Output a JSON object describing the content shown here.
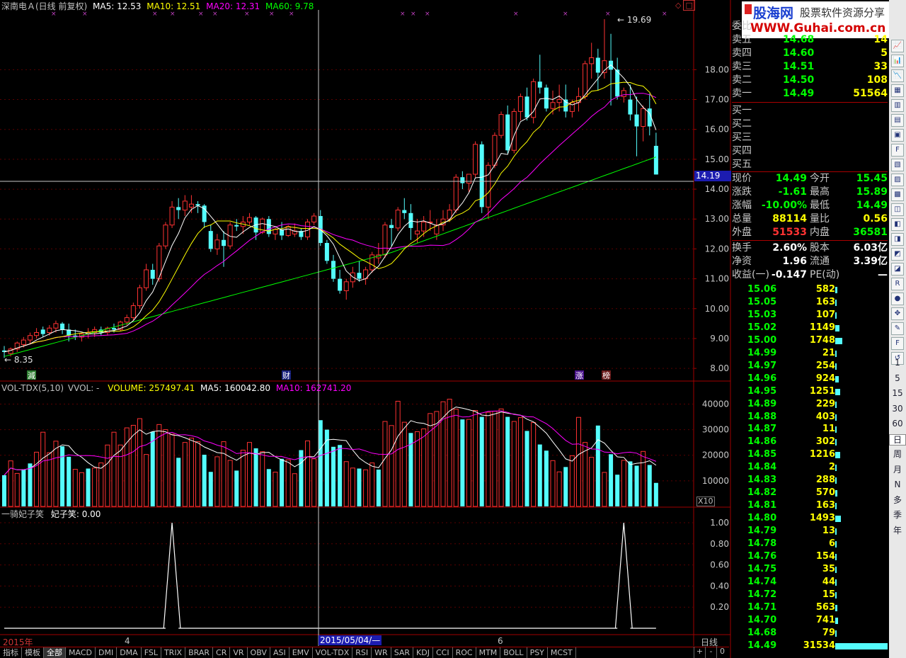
{
  "header": {
    "stock": "深南电Ａ(日线 前复权)",
    "ma5": "MA5: 12.53",
    "ma10": "MA10: 12.51",
    "ma20": "MA20: 12.31",
    "ma60": "MA60: 9.78",
    "peak_label": "19.69",
    "low_label": "8.35",
    "crosshair_price": "14.19",
    "markers": [
      "減",
      "财",
      "涨",
      "榜"
    ]
  },
  "price_axis": [
    "18.00",
    "17.00",
    "16.00",
    "15.00",
    "14.00",
    "13.00",
    "12.00",
    "11.00",
    "10.00",
    "9.00",
    "8.00"
  ],
  "volume_header": {
    "name": "VOL-TDX(5,10)",
    "vvol": "VVOL: -",
    "volume": "VOLUME: 257497.41",
    "ma5": "MA5: 160042.80",
    "ma10": "MA10: 162741.20",
    "axis": [
      "40000",
      "30000",
      "20000",
      "10000"
    ],
    "unit": "X10"
  },
  "indicator_header": {
    "name": "一骑妃子笑",
    "value": "妃子笑: 0.00",
    "axis": [
      "1.00",
      "0.80",
      "0.60",
      "0.40",
      "0.20"
    ]
  },
  "date_axis": {
    "year": "2015年",
    "m4": "4",
    "m6": "6",
    "cursor_date": "2015/05/04/—",
    "period": "日线"
  },
  "toolbar": {
    "tabs": [
      "指标",
      "模板",
      "全部",
      "MACD",
      "DMI",
      "DMA",
      "FSL",
      "TRIX",
      "BRAR",
      "CR",
      "VR",
      "OBV",
      "ASI",
      "EMV",
      "VOL-TDX",
      "RSI",
      "WR",
      "SAR",
      "KDJ",
      "CCI",
      "ROC",
      "MTM",
      "BOLL",
      "PSY",
      "MCST"
    ],
    "zoom": [
      "+",
      "-",
      "0"
    ]
  },
  "logo": {
    "text1": "股海网",
    "text2": "股票软件资源分享",
    "url": "WWW.Guhai.com.cn"
  },
  "order_book": {
    "committee_label": "委比",
    "asks": [
      {
        "label": "卖五",
        "price": "14.68",
        "vol": "14"
      },
      {
        "label": "卖四",
        "price": "14.60",
        "vol": "5"
      },
      {
        "label": "卖三",
        "price": "14.51",
        "vol": "33"
      },
      {
        "label": "卖二",
        "price": "14.50",
        "vol": "108"
      },
      {
        "label": "卖一",
        "price": "14.49",
        "vol": "51564"
      }
    ],
    "bids": [
      {
        "label": "买一"
      },
      {
        "label": "买二"
      },
      {
        "label": "买三"
      },
      {
        "label": "买四"
      },
      {
        "label": "买五"
      }
    ]
  },
  "quote": [
    {
      "l1": "现价",
      "v1": "14.49",
      "l2": "今开",
      "v2": "15.45"
    },
    {
      "l1": "涨跌",
      "v1": "-1.61",
      "l2": "最高",
      "v2": "15.89"
    },
    {
      "l1": "涨幅",
      "v1": "-10.00%",
      "l2": "最低",
      "v2": "14.49"
    },
    {
      "l1": "总量",
      "v1": "88114",
      "l2": "量比",
      "v2": "0.56"
    },
    {
      "l1": "外盘",
      "v1": "51533",
      "l2": "内盘",
      "v2": "36581"
    },
    {
      "l1": "换手",
      "v1": "2.60%",
      "l2": "股本",
      "v2": "6.03亿"
    },
    {
      "l1": "净资",
      "v1": "1.96",
      "l2": "流通",
      "v2": "3.39亿"
    },
    {
      "l1": "收益(一)",
      "v1": "-0.147",
      "l2": "PE(动)",
      "v2": "—"
    }
  ],
  "ticks": [
    {
      "p": "15.06",
      "v": "582"
    },
    {
      "p": "15.05",
      "v": "163"
    },
    {
      "p": "15.03",
      "v": "107"
    },
    {
      "p": "15.02",
      "v": "1149"
    },
    {
      "p": "15.00",
      "v": "1748"
    },
    {
      "p": "14.99",
      "v": "21"
    },
    {
      "p": "14.97",
      "v": "254"
    },
    {
      "p": "14.96",
      "v": "924"
    },
    {
      "p": "14.95",
      "v": "1251"
    },
    {
      "p": "14.89",
      "v": "229"
    },
    {
      "p": "14.88",
      "v": "403"
    },
    {
      "p": "14.87",
      "v": "11"
    },
    {
      "p": "14.86",
      "v": "302"
    },
    {
      "p": "14.85",
      "v": "1216"
    },
    {
      "p": "14.84",
      "v": "2"
    },
    {
      "p": "14.83",
      "v": "288"
    },
    {
      "p": "14.82",
      "v": "570"
    },
    {
      "p": "14.81",
      "v": "163"
    },
    {
      "p": "14.80",
      "v": "1493"
    },
    {
      "p": "14.79",
      "v": "13"
    },
    {
      "p": "14.78",
      "v": "6"
    },
    {
      "p": "14.76",
      "v": "154"
    },
    {
      "p": "14.75",
      "v": "35"
    },
    {
      "p": "14.74",
      "v": "44"
    },
    {
      "p": "14.72",
      "v": "15"
    },
    {
      "p": "14.71",
      "v": "563"
    },
    {
      "p": "14.70",
      "v": "741"
    },
    {
      "p": "14.68",
      "v": "79"
    },
    {
      "p": "14.49",
      "v": "31534"
    }
  ],
  "side_toolbar": {
    "periods": [
      "1",
      "5",
      "15",
      "30",
      "60",
      "日",
      "周",
      "月",
      "N",
      "多",
      "季",
      "年"
    ]
  },
  "colors": {
    "up": "#ff3232",
    "down": "#54fcfc",
    "ma5": "#ffffff",
    "ma10": "#ffff00",
    "ma20": "#ff00ff",
    "ma60": "#00ff00",
    "axis": "#a00000"
  },
  "chart_data": {
    "type": "candlestick",
    "ohlc": [
      [
        8.6,
        8.75,
        8.35,
        8.55
      ],
      [
        8.5,
        8.7,
        8.4,
        8.65
      ],
      [
        8.65,
        8.9,
        8.55,
        8.85
      ],
      [
        8.8,
        9.05,
        8.7,
        8.95
      ],
      [
        8.95,
        9.2,
        8.8,
        9.1
      ],
      [
        9.1,
        9.35,
        9.0,
        9.2
      ],
      [
        9.3,
        9.4,
        9.05,
        9.15
      ],
      [
        9.2,
        9.45,
        9.1,
        9.35
      ],
      [
        9.35,
        9.6,
        9.2,
        9.5
      ],
      [
        9.5,
        9.55,
        9.15,
        9.3
      ],
      [
        9.3,
        9.5,
        8.9,
        9.1
      ],
      [
        9.1,
        9.3,
        8.95,
        9.05
      ],
      [
        9.05,
        9.2,
        8.9,
        9.15
      ],
      [
        9.15,
        9.35,
        9.0,
        9.2
      ],
      [
        9.2,
        9.4,
        9.05,
        9.3
      ],
      [
        9.3,
        9.4,
        9.1,
        9.2
      ],
      [
        9.2,
        9.4,
        9.1,
        9.35
      ],
      [
        9.35,
        9.5,
        9.2,
        9.3
      ],
      [
        9.3,
        9.6,
        9.25,
        9.55
      ],
      [
        9.55,
        9.8,
        9.45,
        9.7
      ],
      [
        9.7,
        10.2,
        9.6,
        10.1
      ],
      [
        10.1,
        10.8,
        10.0,
        10.7
      ],
      [
        10.7,
        11.5,
        10.6,
        11.3
      ],
      [
        11.3,
        11.5,
        10.8,
        11.0
      ],
      [
        11.0,
        12.2,
        10.9,
        12.1
      ],
      [
        12.1,
        12.9,
        12.0,
        12.8
      ],
      [
        12.8,
        13.6,
        12.7,
        13.4
      ],
      [
        13.4,
        13.7,
        13.0,
        13.3
      ],
      [
        13.3,
        13.8,
        13.1,
        13.6
      ],
      [
        13.4,
        13.8,
        13.2,
        13.5
      ],
      [
        13.5,
        13.6,
        13.2,
        13.45
      ],
      [
        13.45,
        13.5,
        12.7,
        12.9
      ],
      [
        12.6,
        12.8,
        11.9,
        12.0
      ],
      [
        12.0,
        12.5,
        11.8,
        12.3
      ],
      [
        12.3,
        12.6,
        11.4,
        12.1
      ],
      [
        12.1,
        12.9,
        12.0,
        12.8
      ],
      [
        12.8,
        13.0,
        12.6,
        12.75
      ],
      [
        12.75,
        13.1,
        12.5,
        12.9
      ],
      [
        12.9,
        13.2,
        12.8,
        13.05
      ],
      [
        13.05,
        13.1,
        12.3,
        12.55
      ],
      [
        12.55,
        13.05,
        12.5,
        13.0
      ],
      [
        13.0,
        13.1,
        12.4,
        12.5
      ],
      [
        12.5,
        12.7,
        12.3,
        12.65
      ],
      [
        12.65,
        12.9,
        12.3,
        12.45
      ],
      [
        12.45,
        12.8,
        12.4,
        12.75
      ],
      [
        12.5,
        12.85,
        12.4,
        12.6
      ],
      [
        12.6,
        12.7,
        12.3,
        12.4
      ],
      [
        12.4,
        13.0,
        12.3,
        12.9
      ],
      [
        12.9,
        13.2,
        12.8,
        13.1
      ],
      [
        13.1,
        13.3,
        12.1,
        12.2
      ],
      [
        12.2,
        12.3,
        11.5,
        11.6
      ],
      [
        11.6,
        11.8,
        10.9,
        11.0
      ],
      [
        11.0,
        11.3,
        10.5,
        10.6
      ],
      [
        10.6,
        11.0,
        10.3,
        10.9
      ],
      [
        10.9,
        11.4,
        10.7,
        11.2
      ],
      [
        11.2,
        11.6,
        10.9,
        11.0
      ],
      [
        11.0,
        11.4,
        10.8,
        11.3
      ],
      [
        11.3,
        11.9,
        11.2,
        11.8
      ],
      [
        11.7,
        12.2,
        11.5,
        11.8
      ],
      [
        11.8,
        12.9,
        11.7,
        12.8
      ],
      [
        12.8,
        13.0,
        12.1,
        12.7
      ],
      [
        12.7,
        13.4,
        12.6,
        13.3
      ],
      [
        13.3,
        13.7,
        13.0,
        13.2
      ],
      [
        13.2,
        13.5,
        12.3,
        12.7
      ],
      [
        12.5,
        13.0,
        12.2,
        12.6
      ],
      [
        12.6,
        13.1,
        12.4,
        12.9
      ],
      [
        12.9,
        13.3,
        12.6,
        12.9
      ],
      [
        12.5,
        13.0,
        12.3,
        12.8
      ],
      [
        12.8,
        13.3,
        12.6,
        13.0
      ],
      [
        13.0,
        13.5,
        12.9,
        13.3
      ],
      [
        13.3,
        14.5,
        13.2,
        14.4
      ],
      [
        14.4,
        14.6,
        14.0,
        14.2
      ],
      [
        14.2,
        14.5,
        13.9,
        14.5
      ],
      [
        14.5,
        15.6,
        14.4,
        15.5
      ],
      [
        15.5,
        15.6,
        13.2,
        13.4
      ],
      [
        13.4,
        14.9,
        13.0,
        14.8
      ],
      [
        14.8,
        15.9,
        14.7,
        15.8
      ],
      [
        15.8,
        16.6,
        15.7,
        16.5
      ],
      [
        16.5,
        16.8,
        15.2,
        15.3
      ],
      [
        15.3,
        16.7,
        15.2,
        16.6
      ],
      [
        16.6,
        17.2,
        16.3,
        17.1
      ],
      [
        17.1,
        17.4,
        16.3,
        16.4
      ],
      [
        16.4,
        17.7,
        16.2,
        17.6
      ],
      [
        17.6,
        18.5,
        17.2,
        17.4
      ],
      [
        17.4,
        17.5,
        16.6,
        16.7
      ],
      [
        16.7,
        17.3,
        16.5,
        16.9
      ],
      [
        16.9,
        17.5,
        16.6,
        17.0
      ],
      [
        17.0,
        17.5,
        16.4,
        16.6
      ],
      [
        16.6,
        17.0,
        16.4,
        16.9
      ],
      [
        16.9,
        17.4,
        16.6,
        17.1
      ],
      [
        17.1,
        18.3,
        17.0,
        18.2
      ],
      [
        18.2,
        18.9,
        17.7,
        18.4
      ],
      [
        18.4,
        18.7,
        17.3,
        17.9
      ],
      [
        17.9,
        19.69,
        17.7,
        18.3
      ],
      [
        18.3,
        19.2,
        16.8,
        18.0
      ],
      [
        18.0,
        18.4,
        17.0,
        17.1
      ],
      [
        17.1,
        17.4,
        16.9,
        17.3
      ],
      [
        17.0,
        17.5,
        16.3,
        16.5
      ],
      [
        16.5,
        17.1,
        15.1,
        16.1
      ],
      [
        16.1,
        16.8,
        15.6,
        16.7
      ],
      [
        16.7,
        17.2,
        15.8,
        16.1
      ],
      [
        15.45,
        15.89,
        14.49,
        14.49
      ]
    ],
    "volume": [
      12200,
      17800,
      12900,
      14500,
      16800,
      21200,
      29000,
      21000,
      25500,
      23500,
      19400,
      14500,
      13200,
      14800,
      15000,
      17000,
      24000,
      29000,
      24000,
      30700,
      31700,
      34300,
      20300,
      29200,
      32000,
      30000,
      28200,
      19000,
      25000,
      26700,
      25300,
      20200,
      13500,
      19400,
      25300,
      18000,
      14000,
      22000,
      25000,
      22700,
      21400,
      14600,
      13400,
      18600,
      18200,
      12800,
      22000,
      25600,
      18600,
      33700,
      30000,
      23300,
      24000,
      17500,
      15000,
      14800,
      14300,
      17000,
      14400,
      33200,
      31600,
      41100,
      32900,
      28700,
      29200,
      30300,
      36300,
      37100,
      40900,
      41900,
      38000,
      34000,
      34000,
      37500,
      35000,
      36800,
      37200,
      38100,
      35000,
      33200,
      34700,
      29500,
      32800,
      24200,
      21800,
      17900,
      13500,
      15400,
      19800,
      34800,
      25000,
      19200,
      31600,
      13300,
      20400,
      12400,
      18000,
      17600,
      15900,
      21500,
      16200,
      9200
    ],
    "up_flags": [
      0,
      1,
      1,
      0,
      0,
      1,
      1,
      1,
      1,
      0,
      0,
      1,
      1,
      0,
      1,
      1,
      1,
      1,
      1,
      1,
      1,
      1,
      1,
      0,
      1,
      1,
      1,
      0,
      1,
      1,
      1,
      0,
      0,
      1,
      1,
      1,
      0,
      1,
      1,
      0,
      1,
      0,
      1,
      0,
      1,
      1,
      0,
      1,
      1,
      0,
      0,
      0,
      0,
      1,
      1,
      0,
      1,
      1,
      0,
      1,
      1,
      1,
      1,
      0,
      1,
      1,
      1,
      1,
      1,
      1,
      1,
      0,
      1,
      1,
      0,
      1,
      1,
      1,
      0,
      1,
      1,
      0,
      1,
      0,
      0,
      1,
      1,
      0,
      1,
      1,
      1,
      1,
      0,
      1,
      0,
      0,
      1,
      0,
      0,
      1,
      0,
      0
    ],
    "ma5_values": [],
    "indicator_spikes": [
      26,
      96
    ],
    "price_ylim": [
      7.6,
      20.0
    ],
    "volume_ylim": [
      0,
      44000
    ],
    "indicator_ylim": [
      0,
      1.0
    ]
  }
}
